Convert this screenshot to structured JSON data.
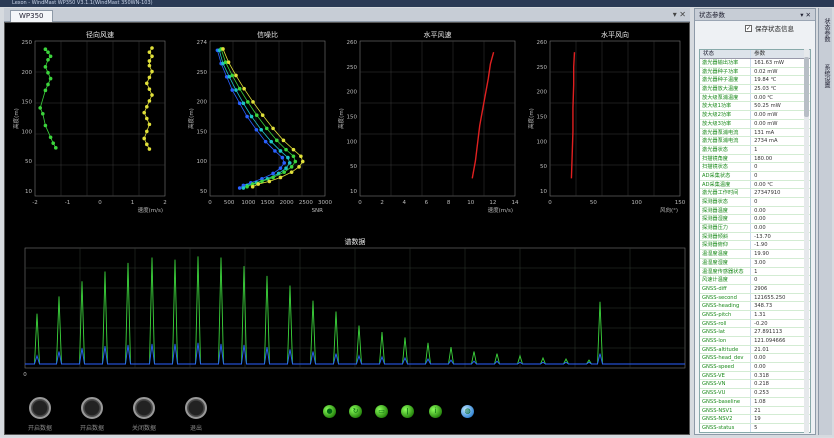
{
  "window": {
    "title": "Lexon - WindMast WP350 V3.1.1(WindMast 350WN-103)",
    "active_tab": "WP350"
  },
  "charts": [
    {
      "title": "径向风速",
      "xlabel": "速度(m/s)",
      "ylabel": "高度(m)",
      "xticks": [
        "-2",
        "-1",
        "0",
        "1",
        "2"
      ],
      "yticks": [
        "250",
        "200",
        "150",
        "100",
        "50",
        "10"
      ]
    },
    {
      "title": "信噪比",
      "xlabel": "SNR",
      "ylabel": "高度(m)",
      "xticks": [
        "0",
        "500",
        "1000",
        "1500",
        "2000",
        "2500",
        "3000"
      ],
      "yticks": [
        "274",
        "250",
        "200",
        "150",
        "100",
        "50"
      ]
    },
    {
      "title": "水平风速",
      "xlabel": "速度(m/s)",
      "ylabel": "高度(m)",
      "xticks": [
        "0",
        "2",
        "4",
        "6",
        "8",
        "10",
        "12",
        "14"
      ],
      "yticks": [
        "260",
        "250",
        "200",
        "150",
        "100",
        "50",
        "10"
      ]
    },
    {
      "title": "水平风向",
      "xlabel": "风向(°)",
      "ylabel": "高度(m)",
      "xticks": [
        "0",
        "50",
        "100",
        "150"
      ],
      "yticks": [
        "260",
        "250",
        "200",
        "150",
        "100",
        "50",
        "10"
      ]
    },
    {
      "title": "谱数据",
      "xlabel": "",
      "ylabel": "",
      "xticks": [
        "0"
      ],
      "yticks": []
    }
  ],
  "chart_data": [
    {
      "type": "scatter",
      "title": "径向风速",
      "xlabel": "速度(m/s)",
      "ylabel": "高度(m)",
      "xlim": [
        -2.2,
        2.8
      ],
      "ylim": [
        10,
        274
      ],
      "grid": true,
      "series": [
        {
          "color": "#3cd43c",
          "x": [
            -1.8,
            -1.7,
            -1.6,
            -1.7,
            -1.8,
            -1.7,
            -1.6,
            -1.7,
            -1.8,
            -2.0,
            -1.9,
            -1.8,
            -1.6,
            -1.5,
            -1.4
          ],
          "y": [
            260,
            255,
            248,
            242,
            230,
            220,
            210,
            200,
            190,
            160,
            150,
            130,
            110,
            100,
            92
          ]
        },
        {
          "color": "#e0e03a",
          "x": [
            2.3,
            2.2,
            2.3,
            2.2,
            2.2,
            2.3,
            2.2,
            2.1,
            2.2,
            2.3,
            2.2,
            2.1,
            2.0,
            2.1,
            2.2,
            2.1,
            2.0,
            2.1,
            2.2
          ],
          "y": [
            262,
            255,
            248,
            240,
            232,
            222,
            212,
            202,
            192,
            182,
            172,
            162,
            152,
            142,
            132,
            120,
            108,
            98,
            90
          ]
        }
      ]
    },
    {
      "type": "scatter",
      "title": "信噪比",
      "xlabel": "SNR",
      "ylabel": "高度(m)",
      "xlim": [
        0,
        3100
      ],
      "ylim": [
        40,
        274
      ],
      "grid": true,
      "series": [
        {
          "color": "#2a60ff",
          "x": [
            200,
            300,
            450,
            600,
            800,
            1000,
            1250,
            1500,
            1750,
            1950,
            2000,
            1900,
            1700,
            1400,
            1100,
            900,
            800
          ],
          "y": [
            260,
            240,
            220,
            200,
            180,
            160,
            140,
            122,
            108,
            98,
            90,
            82,
            74,
            66,
            60,
            56,
            52
          ]
        },
        {
          "color": "#1fc4c4",
          "x": [
            250,
            350,
            520,
            700,
            900,
            1120,
            1380,
            1650,
            1900,
            2100,
            2150,
            2050,
            1850,
            1550,
            1250,
            1000,
            900
          ],
          "y": [
            260,
            240,
            220,
            200,
            180,
            160,
            140,
            122,
            108,
            98,
            90,
            82,
            74,
            66,
            60,
            56,
            52
          ]
        },
        {
          "color": "#3cd43c",
          "x": [
            300,
            420,
            600,
            800,
            1020,
            1260,
            1530,
            1800,
            2050,
            2250,
            2300,
            2200,
            2000,
            1700,
            1400,
            1150,
            1000
          ],
          "y": [
            262,
            242,
            222,
            202,
            182,
            162,
            142,
            124,
            110,
            100,
            92,
            84,
            76,
            68,
            62,
            58,
            54
          ]
        },
        {
          "color": "#e0e03a",
          "x": [
            350,
            500,
            700,
            920,
            1160,
            1420,
            1700,
            1980,
            2250,
            2450,
            2500,
            2400,
            2200,
            1900,
            1600,
            1300,
            1150
          ],
          "y": [
            262,
            242,
            222,
            202,
            182,
            162,
            142,
            124,
            110,
            100,
            92,
            84,
            76,
            68,
            62,
            58,
            54
          ]
        }
      ]
    },
    {
      "type": "line",
      "title": "水平风速",
      "xlabel": "速度(m/s)",
      "ylabel": "高度(m)",
      "xlim": [
        0,
        14.5
      ],
      "ylim": [
        10,
        274
      ],
      "grid": true,
      "series": [
        {
          "color": "#e02020",
          "x": [
            10.5,
            10.8,
            11.0,
            11.2,
            11.5,
            11.8,
            12.0,
            12.2,
            12.5
          ],
          "y": [
            40,
            70,
            100,
            130,
            160,
            190,
            210,
            235,
            255
          ]
        }
      ]
    },
    {
      "type": "line",
      "title": "水平风向",
      "xlabel": "风向(°)",
      "ylabel": "高度(m)",
      "xlim": [
        0,
        170
      ],
      "ylim": [
        10,
        274
      ],
      "grid": true,
      "series": [
        {
          "color": "#e02020",
          "x": [
            28,
            29,
            30,
            30,
            31,
            31,
            32
          ],
          "y": [
            40,
            80,
            120,
            160,
            200,
            230,
            255
          ]
        }
      ]
    },
    {
      "type": "line",
      "title": "谱数据",
      "xlim": [
        0,
        660
      ],
      "ylim": [
        0,
        1
      ],
      "grid": true,
      "series": [
        {
          "color": "#3cd43c",
          "peaks_x": [
            12,
            34,
            57,
            80,
            103,
            127,
            150,
            173,
            196,
            219,
            242,
            265,
            288,
            311,
            334,
            357,
            380,
            403,
            426,
            449,
            472,
            495,
            518,
            541,
            564,
            575
          ],
          "peaks_y": [
            0.47,
            0.63,
            0.77,
            0.86,
            0.94,
            0.99,
            0.97,
            1.0,
            0.99,
            0.91,
            0.82,
            0.73,
            0.59,
            0.49,
            0.36,
            0.3,
            0.25,
            0.2,
            0.16,
            0.12,
            0.1,
            0.08,
            0.06,
            0.05,
            0.04,
            0.58
          ]
        },
        {
          "color": "#2a60ff",
          "peaks_x": [
            12,
            34,
            57,
            80,
            103,
            127,
            150,
            173,
            196,
            219,
            242,
            265,
            288,
            311,
            334,
            357,
            380,
            403,
            426,
            449,
            472,
            495,
            518,
            541,
            564,
            575
          ],
          "peaks_y": [
            0.08,
            0.12,
            0.15,
            0.17,
            0.18,
            0.19,
            0.19,
            0.2,
            0.19,
            0.18,
            0.16,
            0.14,
            0.12,
            0.1,
            0.08,
            0.07,
            0.06,
            0.05,
            0.04,
            0.03,
            0.03,
            0.02,
            0.02,
            0.02,
            0.02,
            0.1
          ]
        }
      ]
    }
  ],
  "controls": {
    "ring_buttons": [
      "开启数据",
      "开启数据",
      "关闭数据",
      "退出"
    ],
    "tool_icons": [
      "record-icon",
      "refresh-icon",
      "folder-icon",
      "thermometer-icon",
      "info-icon",
      "globe-icon"
    ]
  },
  "side_panel": {
    "title": "状态参数",
    "checkbox_label": "保存状态信息",
    "checkbox_checked": true,
    "col1": "状态",
    "col2": "参数",
    "rows": [
      [
        "激光器输出功率",
        "161.63 mW"
      ],
      [
        "激光器种子功率",
        "0.02 mW"
      ],
      [
        "激光器种子温度",
        "19.84 ℃"
      ],
      [
        "激光器放大温度",
        "25.03 ℃"
      ],
      [
        "放大级泵浦温度",
        "0.00 ℃"
      ],
      [
        "放大级1功率",
        "50.25 mW"
      ],
      [
        "放大级2功率",
        "0.00 mW"
      ],
      [
        "放大级3功率",
        "0.00 mW"
      ],
      [
        "激光器泵浦电流",
        "131 mA"
      ],
      [
        "激光器泵浦电流",
        "2734 mA"
      ],
      [
        "激光器状态",
        "1"
      ],
      [
        "扫描镜角度",
        "180.00"
      ],
      [
        "扫描镜状态",
        "0"
      ],
      [
        "AD采集状态",
        "0"
      ],
      [
        "AD采集温度",
        "0.00 ℃"
      ],
      [
        "激光器工作时间",
        "27347910"
      ],
      [
        "探测器状态",
        "0"
      ],
      [
        "探测器温度",
        "0.00"
      ],
      [
        "探测器湿度",
        "0.00"
      ],
      [
        "探测器压力",
        "0.00"
      ],
      [
        "探测器倾斜",
        "-13.70"
      ],
      [
        "探测器俯仰",
        "-1.90"
      ],
      [
        "温湿度温度",
        "19.90"
      ],
      [
        "温湿度湿度",
        "3.00"
      ],
      [
        "温湿度传感器状态",
        "1"
      ],
      [
        "风速计温度",
        "0"
      ],
      [
        "GNSS-diff",
        "2906"
      ],
      [
        "GNSS-second",
        "121655.250"
      ],
      [
        "GNSS-heading",
        "348.73"
      ],
      [
        "GNSS-pitch",
        "1.31"
      ],
      [
        "GNSS-roll",
        "-0.20"
      ],
      [
        "GNSS-lat",
        "27.891113"
      ],
      [
        "GNSS-lon",
        "121.094666"
      ],
      [
        "GNSS-altitude",
        "21.01"
      ],
      [
        "GNSS-head_dev",
        "0.00"
      ],
      [
        "GNSS-speed",
        "0.00"
      ],
      [
        "GNSS-VE",
        "0.318"
      ],
      [
        "GNSS-VN",
        "0.218"
      ],
      [
        "GNSS-VU",
        "0.253"
      ],
      [
        "GNSS-baseline",
        "1.08"
      ],
      [
        "GNSS-NSV1",
        "21"
      ],
      [
        "GNSS-NSV2",
        "19"
      ],
      [
        "GNSS-status",
        "5"
      ]
    ]
  },
  "right_strip": {
    "tabs": [
      "状态参数",
      "系统设置"
    ]
  }
}
